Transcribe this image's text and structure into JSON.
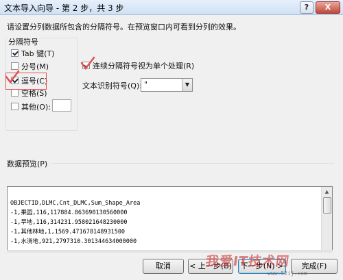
{
  "window": {
    "title": "文本导入向导 - 第 2 步，共 3 步",
    "help_label": "?",
    "close_label": "X"
  },
  "instructions": "请设置分列数据所包含的分隔符号。在预览窗口内可看到分列的效果。",
  "delimiters": {
    "group_title": "分隔符号",
    "tab": {
      "label": "Tab 键(T)",
      "checked": true
    },
    "semicolon": {
      "label": "分号(M)",
      "checked": false
    },
    "comma": {
      "label": "逗号(C)",
      "checked": true
    },
    "space": {
      "label": "空格(S)",
      "checked": false
    },
    "other": {
      "label": "其他(O):",
      "checked": false,
      "value": ""
    }
  },
  "consecutive": {
    "label": "连续分隔符号视为单个处理(R)",
    "checked": true
  },
  "text_qualifier": {
    "label": "文本识别符号(Q):",
    "value": "\""
  },
  "preview": {
    "label": "数据预览(P)",
    "lines": [
      "OBJECTID,DLMC,Cnt_DLMC,Sum_Shape_Area",
      "-1,果园,116,117884.863690130560000",
      "-1,旱地,116,314231.958021648230000",
      "-1,其他林地,1,1569.471678148931500",
      "-1,水浇地,921,2797310.301344634000000"
    ]
  },
  "buttons": {
    "cancel": "取消",
    "back": "< 上一步(B)",
    "next": "下一步(N) >",
    "finish": "完成(F)"
  },
  "watermark": {
    "text": "我爱IT技术网",
    "url": "www.52ij.com"
  },
  "colors": {
    "annotation_red": "#e05050",
    "dialog_bg": "#f0f0f0"
  }
}
